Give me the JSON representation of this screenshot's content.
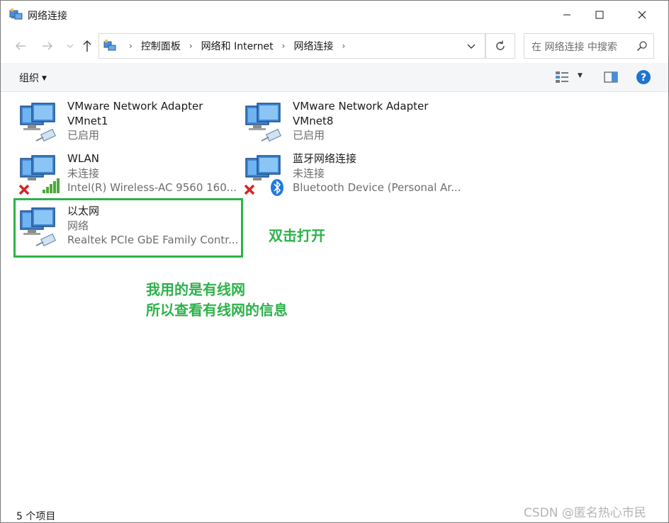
{
  "window": {
    "title": "网络连接"
  },
  "nav": {
    "breadcrumbs": [
      "控制面板",
      "网络和 Internet",
      "网络连接"
    ],
    "search_placeholder": "在 网络连接 中搜索"
  },
  "toolbar": {
    "organize_label": "组织"
  },
  "connections": [
    {
      "name_line1": "VMware Network Adapter",
      "name_line2": "VMnet1",
      "status": "已启用",
      "device": "",
      "icon": "ethernet-adapter-icon",
      "badge": "cable-icon"
    },
    {
      "name_line1": "VMware Network Adapter",
      "name_line2": "VMnet8",
      "status": "已启用",
      "device": "",
      "icon": "ethernet-adapter-icon",
      "badge": "cable-icon"
    },
    {
      "name_line1": "WLAN",
      "name_line2": "",
      "status": "未连接",
      "device": "Intel(R) Wireless-AC 9560 160...",
      "icon": "wireless-adapter-icon",
      "badge": "signal-bars-icon",
      "error": "red-x-icon"
    },
    {
      "name_line1": "蓝牙网络连接",
      "name_line2": "",
      "status": "未连接",
      "device": "Bluetooth Device (Personal Ar...",
      "icon": "bluetooth-adapter-icon",
      "badge": "bluetooth-icon",
      "error": "red-x-icon"
    },
    {
      "name_line1": "以太网",
      "name_line2": "",
      "status": "网络",
      "device": "Realtek PCIe GbE Family Contr...",
      "icon": "ethernet-adapter-icon",
      "badge": "cable-icon"
    }
  ],
  "annotations": {
    "double_click": "双击打开",
    "note_line1": "我用的是有线网",
    "note_line2": "所以查看有线网的信息",
    "color": "#2db24a"
  },
  "status": {
    "item_count": "5 个项目",
    "watermark": "CSDN @匿名热心市民"
  }
}
